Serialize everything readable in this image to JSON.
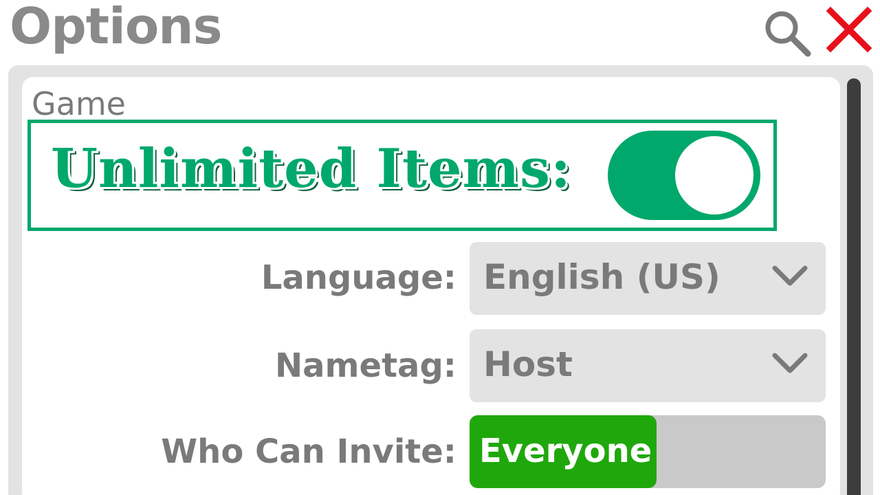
{
  "header": {
    "title": "Options"
  },
  "icons": {
    "search": "search-icon",
    "close": "close-icon",
    "chevron": "chevron-down-icon"
  },
  "colors": {
    "accent_green": "#00a86b",
    "active_segment_green": "#1fa80b",
    "close_red": "#e8101a",
    "label_gray": "#7a7a7a",
    "panel_gray": "#e3e3e3"
  },
  "section": {
    "label": "Game"
  },
  "unlimited_items": {
    "label": "Unlimited Items:",
    "enabled": true
  },
  "settings": {
    "language": {
      "label": "Language:",
      "value": "English (US)"
    },
    "nametag": {
      "label": "Nametag:",
      "value": "Host"
    },
    "who_can_invite": {
      "label": "Who Can Invite:",
      "selected": "Everyone"
    }
  }
}
